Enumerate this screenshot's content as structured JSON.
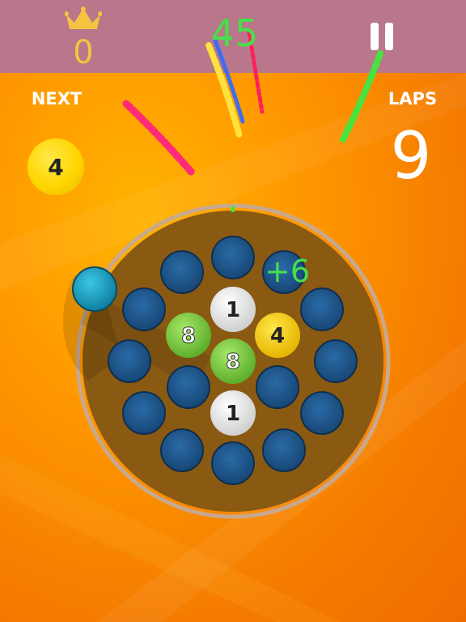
{
  "header": {
    "best_score": "0",
    "score": "45",
    "icons": {
      "best": "crown-icon",
      "pause": "pause-icon"
    }
  },
  "next": {
    "label": "NEXT",
    "value": "4"
  },
  "laps": {
    "label": "LAPS",
    "value": "9"
  },
  "board": {
    "bonus_text": "+6",
    "balls": [
      {
        "type": "white",
        "value": "1"
      },
      {
        "type": "green",
        "value": "8"
      },
      {
        "type": "yellow",
        "value": "4"
      },
      {
        "type": "green",
        "value": "8"
      },
      {
        "type": "white",
        "value": "1"
      }
    ]
  },
  "colors": {
    "score": "#46e04a",
    "best_score": "#f5c242",
    "topbar": "#b8778a",
    "slot": "#1f5a8f",
    "ball_yellow": "#ffd600",
    "ball_green": "#7ccf3c",
    "ball_white": "#e6e6e6"
  }
}
